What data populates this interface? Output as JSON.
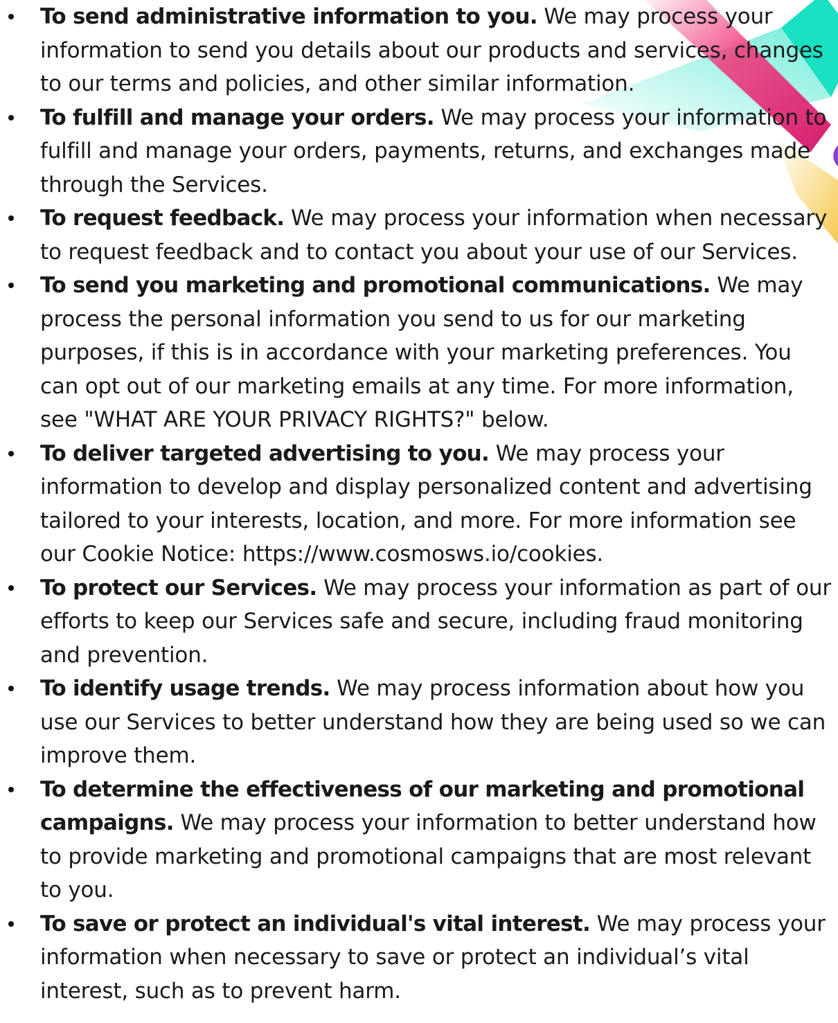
{
  "decoration": {
    "colors": {
      "teal": "#19e0c2",
      "pink": "#f0367a",
      "magenta": "#d41d6f",
      "yellow": "#f6c94f",
      "purple": "#8a3fd6"
    }
  },
  "items": [
    {
      "title": "To send administrative information to you.",
      "body": " We may process your information to send you details about our products and services, changes to our terms and policies, and other similar information."
    },
    {
      "title": "To fulfill and manage your orders.",
      "body": " We may process your information to fulfill and manage your orders, payments, returns, and exchanges made through the Services."
    },
    {
      "title": "To request feedback.",
      "body": " We may process your information when necessary to request feedback and to contact you about your use of our Services."
    },
    {
      "title": "To send you marketing and promotional communications.",
      "body": " We may process the personal information you send to us for our marketing purposes, if this is in accordance with your marketing preferences. You can opt out of our marketing emails at any time. For more information, see \"WHAT ARE YOUR PRIVACY RIGHTS?\" below."
    },
    {
      "title": "To deliver targeted advertising to you.",
      "body": " We may process your information to develop and display personalized content and advertising tailored to your interests, location, and more. For more information see our Cookie Notice: https://www.cosmosws.io/cookies."
    },
    {
      "title": "To protect our Services.",
      "body": " We may process your information as part of our efforts to keep our Services safe and secure, including fraud monitoring and prevention."
    },
    {
      "title": "To identify usage trends.",
      "body": " We may process information about how you use our Services to better understand how they are being used so we can improve them."
    },
    {
      "title": "To determine the effectiveness of our marketing and promotional campaigns.",
      "body": " We may process your information to better understand how to provide marketing and promotional campaigns that are most relevant to you."
    },
    {
      "title": "To save or protect an individual's vital interest.",
      "body": " We may process your information when necessary to save or protect an individual’s vital interest, such as to prevent harm."
    }
  ]
}
